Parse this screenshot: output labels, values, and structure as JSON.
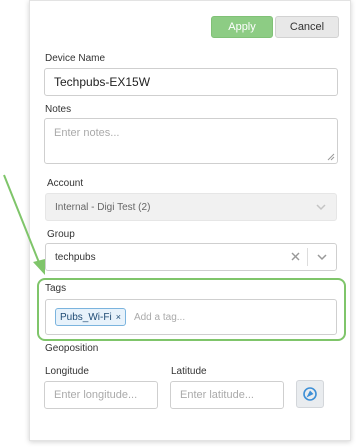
{
  "buttons": {
    "apply": "Apply",
    "cancel": "Cancel"
  },
  "device_name": {
    "label": "Device Name",
    "value": "Techpubs-EX15W"
  },
  "notes": {
    "label": "Notes",
    "placeholder": "Enter notes..."
  },
  "account": {
    "label": "Account",
    "value": "Internal - Digi Test (2)"
  },
  "group": {
    "label": "Group",
    "value": "techpubs"
  },
  "tags": {
    "label": "Tags",
    "items": [
      "Pubs_Wi-Fi"
    ],
    "remove_glyph": "×",
    "placeholder": "Add a tag..."
  },
  "geoposition": {
    "label": "Geoposition",
    "longitude": {
      "label": "Longitude",
      "placeholder": "Enter longitude..."
    },
    "latitude": {
      "label": "Latitude",
      "placeholder": "Enter latitude..."
    }
  },
  "colors": {
    "apply_bg": "#8dcc84",
    "highlight": "#7fc56a",
    "tag_border": "#7bb4de",
    "locate_icon": "#3d8fd6"
  },
  "icons": {
    "clear": "clear-icon",
    "chevron": "chevron-down-icon",
    "locate": "locate-icon"
  }
}
